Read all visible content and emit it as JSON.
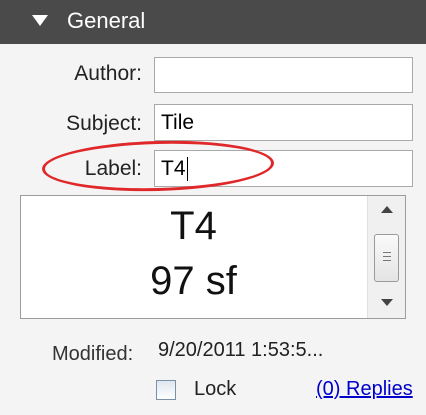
{
  "panel": {
    "title": "General",
    "collapsed": false
  },
  "form": {
    "author": {
      "label": "Author:",
      "value": ""
    },
    "subject": {
      "label": "Subject:",
      "value": "Tile"
    },
    "label": {
      "label": "Label:",
      "value": "T4"
    }
  },
  "preview": {
    "line1": "T4",
    "line2": "97 sf"
  },
  "modified": {
    "label": "Modified:",
    "value": "9/20/2011 1:53:5..."
  },
  "lock": {
    "label": "Lock",
    "checked": false
  },
  "replies": {
    "label": "(0) Replies"
  },
  "colors": {
    "header_bg": "#4a4a4a",
    "panel_bg": "#f4f4f4",
    "highlight_ellipse": "#e0282b",
    "link": "#0000cc"
  },
  "icons": {
    "panel_toggle": "triangle-down-icon",
    "scroll_up": "arrow-up-icon",
    "scroll_down": "arrow-down-icon"
  }
}
